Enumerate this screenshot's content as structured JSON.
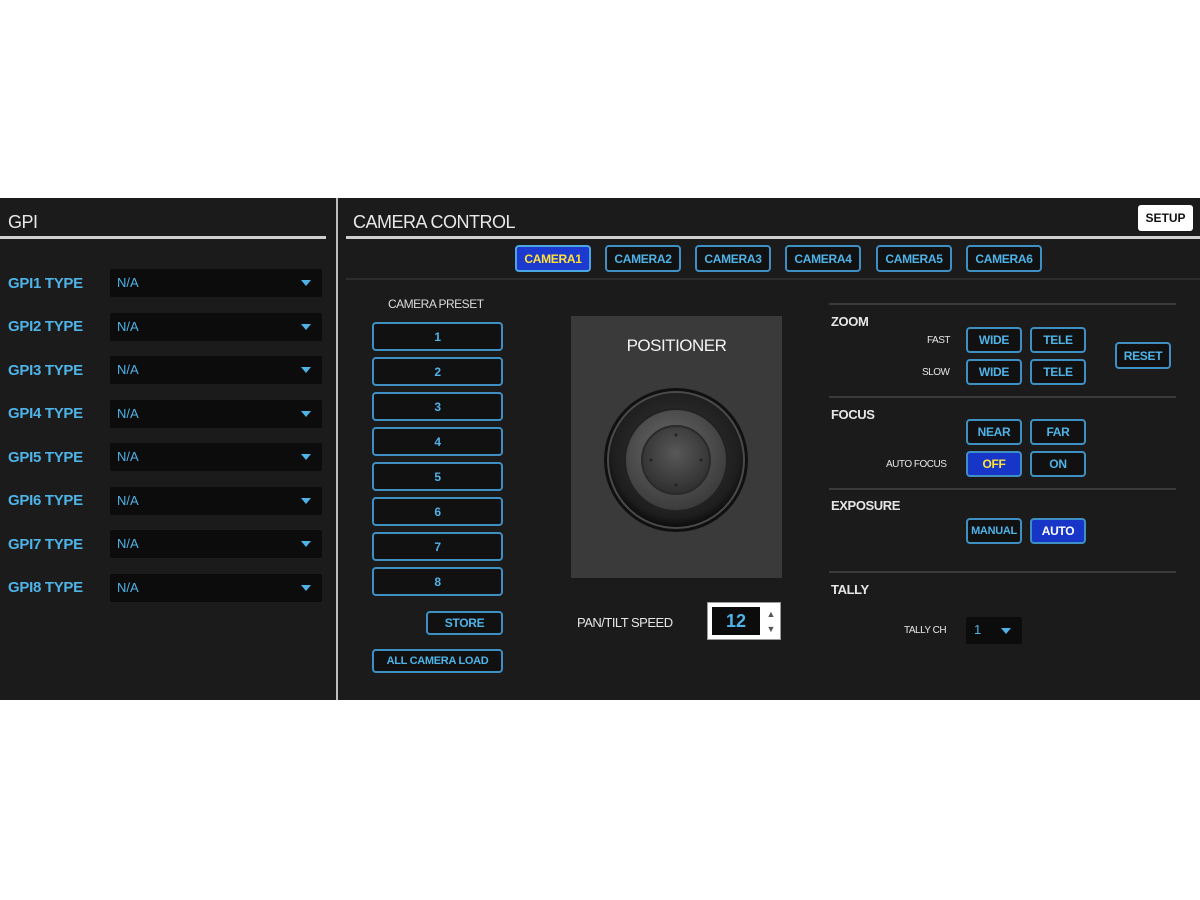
{
  "gpi": {
    "title": "GPI",
    "rows": [
      {
        "label": "GPI1 TYPE",
        "value": "N/A"
      },
      {
        "label": "GPI2 TYPE",
        "value": "N/A"
      },
      {
        "label": "GPI3 TYPE",
        "value": "N/A"
      },
      {
        "label": "GPI4 TYPE",
        "value": "N/A"
      },
      {
        "label": "GPI5 TYPE",
        "value": "N/A"
      },
      {
        "label": "GPI6 TYPE",
        "value": "N/A"
      },
      {
        "label": "GPI7 TYPE",
        "value": "N/A"
      },
      {
        "label": "GPI8 TYPE",
        "value": "N/A"
      }
    ]
  },
  "camera_control": {
    "title": "CAMERA CONTROL",
    "setup_label": "SETUP",
    "camera_tabs": [
      "CAMERA1",
      "CAMERA2",
      "CAMERA3",
      "CAMERA4",
      "CAMERA5",
      "CAMERA6"
    ],
    "active_camera": "CAMERA1",
    "preset": {
      "title": "CAMERA PRESET",
      "buttons": [
        "1",
        "2",
        "3",
        "4",
        "5",
        "6",
        "7",
        "8"
      ],
      "store_label": "STORE",
      "all_load_label": "ALL CAMERA LOAD"
    },
    "positioner": {
      "title": "POSITIONER",
      "speed_label": "PAN/TILT SPEED",
      "speed_value": "12"
    },
    "zoom": {
      "title": "ZOOM",
      "fast_label": "FAST",
      "slow_label": "SLOW",
      "wide_label": "WIDE",
      "tele_label": "TELE",
      "reset_label": "RESET"
    },
    "focus": {
      "title": "FOCUS",
      "near_label": "NEAR",
      "far_label": "FAR",
      "auto_focus_label": "AUTO FOCUS",
      "off_label": "OFF",
      "on_label": "ON",
      "auto_focus_state": "OFF"
    },
    "exposure": {
      "title": "EXPOSURE",
      "manual_label": "MANUAL",
      "auto_label": "AUTO",
      "state": "AUTO"
    },
    "tally": {
      "title": "TALLY",
      "ch_label": "TALLY CH",
      "ch_value": "1"
    }
  },
  "colors": {
    "accent_blue": "#4fb3e8",
    "active_fill": "#1736c8",
    "active_text_yellow": "#ffe23a",
    "panel_bg": "#1b1b1b"
  }
}
